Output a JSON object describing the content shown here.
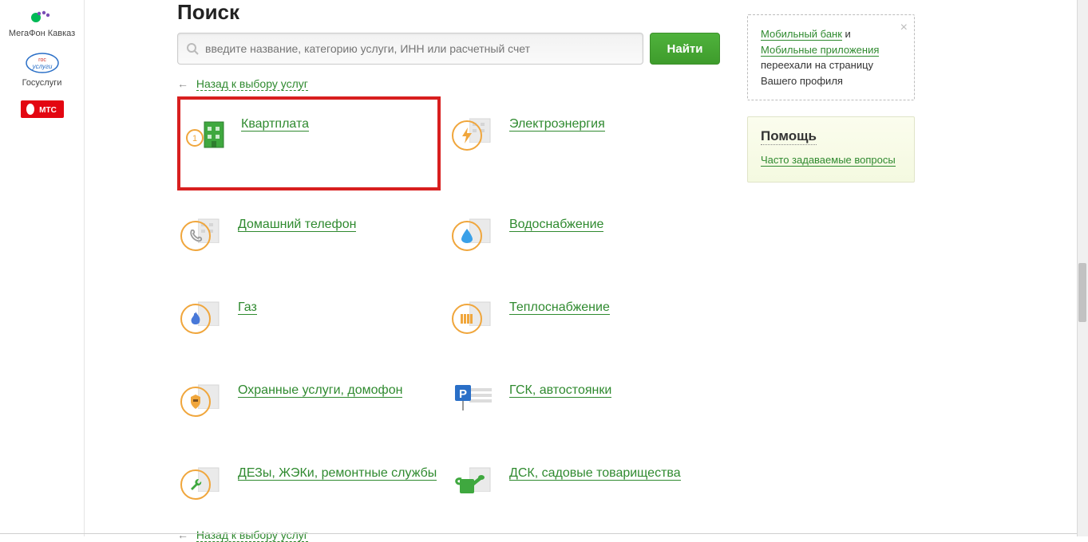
{
  "sidebar": {
    "providers": [
      {
        "label": "МегаФон Кавказ",
        "logo": "megafon"
      },
      {
        "label": "Госуслуги",
        "logo": "gosuslugi"
      },
      {
        "label": "",
        "logo": "mts"
      }
    ]
  },
  "search": {
    "title": "Поиск",
    "placeholder": "введите название, категорию услуги, ИНН или расчетный счет",
    "button": "Найти"
  },
  "back_link": "Назад к выбору услуг",
  "categories": [
    {
      "title": "Квартплата",
      "icon": "building-green",
      "badge": "1",
      "highlight": true
    },
    {
      "title": "Электроэнергия",
      "icon": "bolt"
    },
    {
      "title": "Домашний телефон",
      "icon": "phone"
    },
    {
      "title": "Водоснабжение",
      "icon": "water"
    },
    {
      "title": "Газ",
      "icon": "flame"
    },
    {
      "title": "Теплоснабжение",
      "icon": "radiator"
    },
    {
      "title": "Охранные услуги, домофон",
      "icon": "shield"
    },
    {
      "title": "ГСК, автостоянки",
      "icon": "parking"
    },
    {
      "title": "ДЕЗы, ЖЭКи, ремонтные службы",
      "icon": "wrench"
    },
    {
      "title": "ДСК, садовые товарищества",
      "icon": "watering-can"
    }
  ],
  "notice": {
    "link1": "Мобильный банк",
    "and": " и ",
    "link2": "Мобильные приложения",
    "rest": " переехали на страницу Вашего профиля"
  },
  "help": {
    "title": "Помощь",
    "faq": "Часто задаваемые вопросы"
  },
  "colors": {
    "green": "#2f8a2f",
    "orange": "#f0a63c",
    "highlight": "#d81f1f"
  }
}
